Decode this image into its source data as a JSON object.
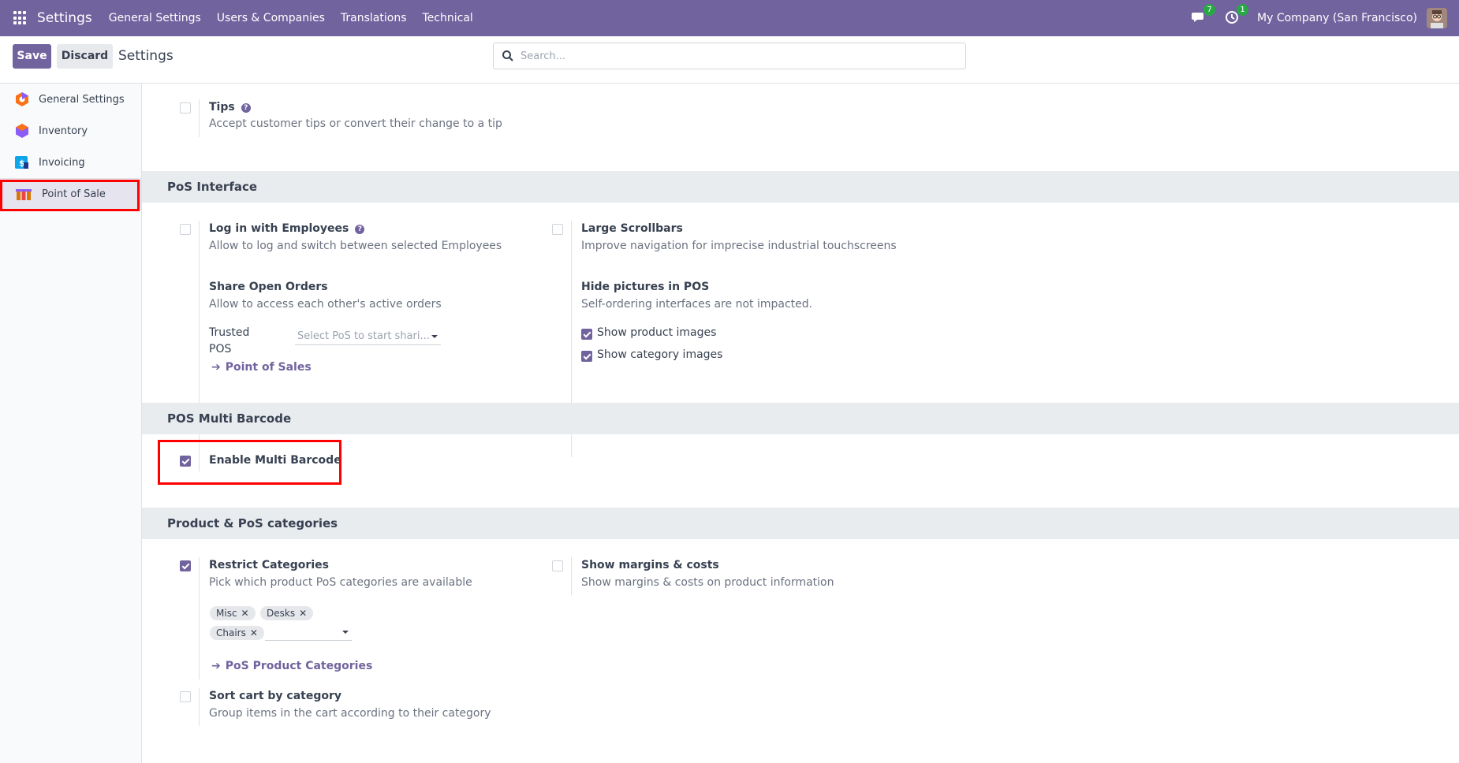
{
  "topbar": {
    "brand": "Settings",
    "menu": [
      "General Settings",
      "Users & Companies",
      "Translations",
      "Technical"
    ],
    "messages_badge": "7",
    "activities_badge": "1",
    "company": "My Company (San Francisco)"
  },
  "control": {
    "save_label": "Save",
    "discard_label": "Discard",
    "breadcrumb": "Settings",
    "search_placeholder": "Search..."
  },
  "sidebar": {
    "items": [
      {
        "label": "General Settings",
        "icon": "general-settings-icon",
        "color": "#f97316"
      },
      {
        "label": "Inventory",
        "icon": "inventory-icon",
        "color": "#8b5cf6"
      },
      {
        "label": "Invoicing",
        "icon": "invoicing-icon",
        "color": "#0ea5e9"
      },
      {
        "label": "Point of Sale",
        "icon": "point-of-sale-icon",
        "color": "#d97706",
        "active": true
      }
    ]
  },
  "settings": {
    "tips": {
      "title": "Tips",
      "desc": "Accept customer tips or convert their change to a tip",
      "checked": false
    },
    "pos_interface": {
      "header": "PoS Interface",
      "login_employees": {
        "title": "Log in with Employees",
        "desc": "Allow to log and switch between selected Employees",
        "checked": false
      },
      "large_scrollbars": {
        "title": "Large Scrollbars",
        "desc": "Improve navigation for imprecise industrial touchscreens",
        "checked": false
      },
      "share_orders": {
        "title": "Share Open Orders",
        "desc": "Allow to access each other's active orders",
        "trusted_label_1": "Trusted",
        "trusted_label_2": "POS",
        "select_placeholder": "Select PoS to start shari...",
        "link": "Point of Sales"
      },
      "hide_pictures": {
        "title": "Hide pictures in POS",
        "desc": "Self-ordering interfaces are not impacted.",
        "opt1": "Show product images",
        "opt2": "Show category images",
        "opt1_checked": true,
        "opt2_checked": true
      }
    },
    "multi_barcode": {
      "header": "POS Multi Barcode",
      "enable": {
        "title": "Enable Multi Barcode",
        "checked": true
      }
    },
    "categories": {
      "header": "Product & PoS categories",
      "restrict": {
        "title": "Restrict Categories",
        "desc": "Pick which product PoS categories are available",
        "checked": true,
        "tags": [
          "Misc",
          "Desks",
          "Chairs"
        ],
        "link": "PoS Product Categories"
      },
      "margins": {
        "title": "Show margins & costs",
        "desc": "Show margins & costs on product information",
        "checked": false
      },
      "sort_cart": {
        "title": "Sort cart by category",
        "desc": "Group items in the cart according to their category",
        "checked": false
      }
    }
  }
}
